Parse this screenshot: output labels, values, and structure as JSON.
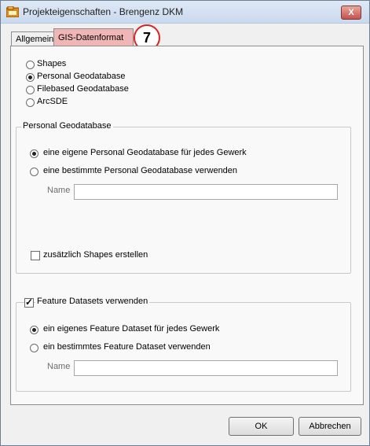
{
  "window": {
    "title": "Projekteigenschaften - Brengenz DKM",
    "close_label": "X"
  },
  "tabs": [
    {
      "label": "Allgemein"
    },
    {
      "label": "GIS-Datenformat"
    }
  ],
  "annotation_badge": "7",
  "format_options": [
    {
      "label": "Shapes",
      "selected": false
    },
    {
      "label": "Personal Geodatabase",
      "selected": true
    },
    {
      "label": "Filebased Geodatabase",
      "selected": false
    },
    {
      "label": "ArcSDE",
      "selected": false
    }
  ],
  "personal_geodatabase": {
    "title": "Personal Geodatabase",
    "options": [
      {
        "label": "eine eigene Personal Geodatabase für jedes Gewerk",
        "selected": true
      },
      {
        "label": "eine bestimmte Personal Geodatabase verwenden",
        "selected": false
      }
    ],
    "name_label": "Name",
    "name_value": "",
    "shapes_checkbox_label": "zusätzlich Shapes erstellen",
    "shapes_checked": false
  },
  "feature_datasets": {
    "checkbox_label": "Feature Datasets verwenden",
    "checked": true,
    "options": [
      {
        "label": "ein eigenes Feature Dataset für jedes Gewerk",
        "selected": true
      },
      {
        "label": "ein bestimmtes Feature Dataset verwenden",
        "selected": false
      }
    ],
    "name_label": "Name",
    "name_value": ""
  },
  "buttons": {
    "ok": "OK",
    "cancel": "Abbrechen"
  }
}
